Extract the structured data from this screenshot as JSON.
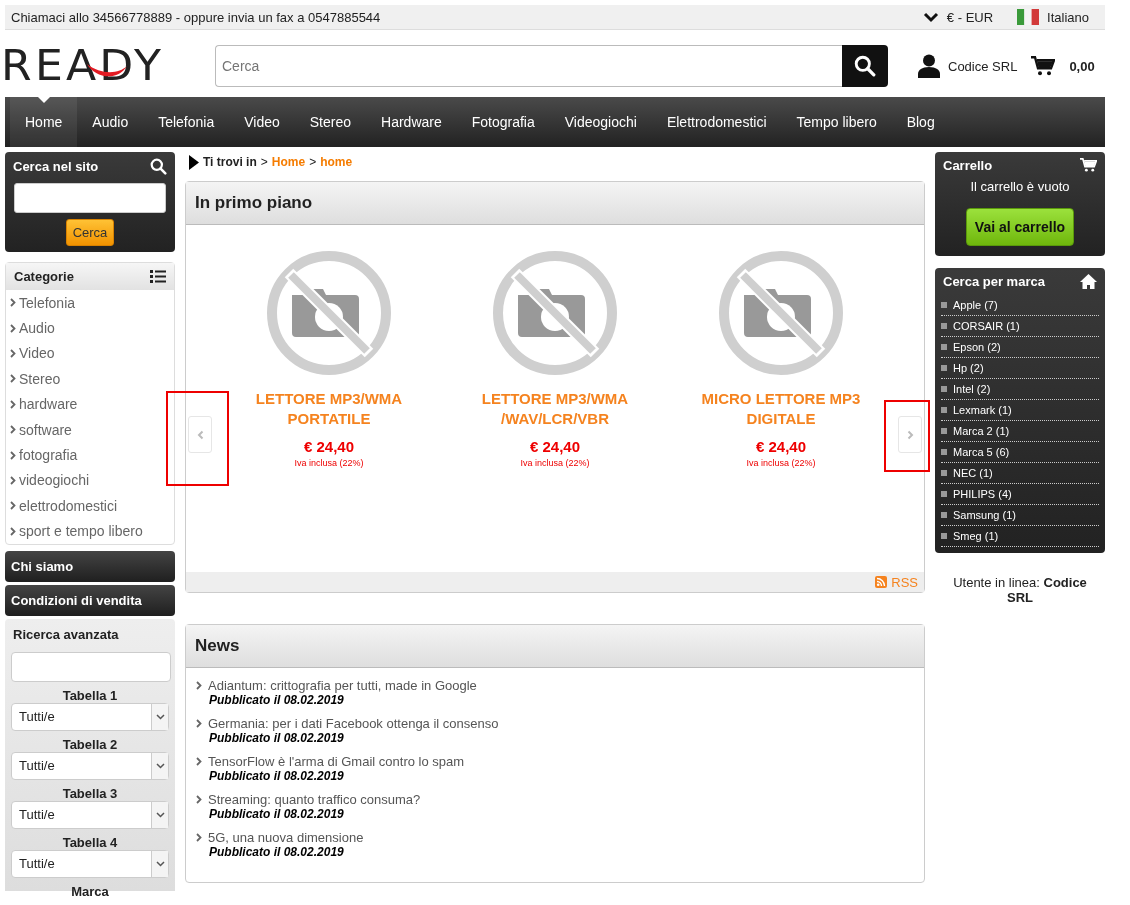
{
  "top_bar": {
    "contact": "Chiamaci allo 34566778889 - oppure invia un fax a 0547885544",
    "currency": "€ - EUR",
    "language": "Italiano"
  },
  "header": {
    "logo": "READY",
    "search": {
      "placeholder": "Cerca"
    },
    "user": "Codice SRL",
    "cart_total": "0,00"
  },
  "nav": [
    {
      "label": "Home",
      "selected": true
    },
    {
      "label": "Audio",
      "selected": false
    },
    {
      "label": "Telefonia",
      "selected": false
    },
    {
      "label": "Video",
      "selected": false
    },
    {
      "label": "Stereo",
      "selected": false
    },
    {
      "label": "Hardware",
      "selected": false
    },
    {
      "label": "Fotografia",
      "selected": false
    },
    {
      "label": "Videogiochi",
      "selected": false
    },
    {
      "label": "Elettrodomestici",
      "selected": false
    },
    {
      "label": "Tempo libero",
      "selected": false
    },
    {
      "label": "Blog",
      "selected": false
    }
  ],
  "left": {
    "site_search": {
      "title": "Cerca nel sito",
      "button": "Cerca"
    },
    "categories": {
      "title": "Categorie",
      "items": [
        "Telefonia",
        "Audio",
        "Video",
        "Stereo",
        "hardware",
        "software",
        "fotografia",
        "videogiochi",
        "elettrodomestici",
        "sport e tempo libero"
      ]
    },
    "links": [
      "Chi siamo",
      "Condizioni di vendita"
    ],
    "advanced_search": {
      "title": "Ricerca avanzata",
      "selects": [
        {
          "label": "Tabella 1",
          "value": "Tutti/e"
        },
        {
          "label": "Tabella 2",
          "value": "Tutti/e"
        },
        {
          "label": "Tabella 3",
          "value": "Tutti/e"
        },
        {
          "label": "Tabella 4",
          "value": "Tutti/e"
        }
      ],
      "next_label": "Marca"
    }
  },
  "breadcrumb": {
    "separator": ">",
    "items": [
      {
        "text": "Ti trovi in",
        "kind": "label"
      },
      {
        "text": "Home",
        "kind": "link"
      },
      {
        "text": "home",
        "kind": "current"
      }
    ]
  },
  "featured": {
    "title": "In primo piano",
    "prev": {
      "highlighted": true
    },
    "next": {
      "highlighted": true
    },
    "products": [
      {
        "name": "LETTORE MP3/WMA PORTATILE",
        "price": "€ 24,40",
        "tax": "Iva inclusa (22%)"
      },
      {
        "name": "LETTORE MP3/WMA /WAV/LCR/VBR",
        "price": "€ 24,40",
        "tax": "Iva inclusa (22%)"
      },
      {
        "name": "MICRO LETTORE MP3 DIGITALE",
        "price": "€ 24,40",
        "tax": "Iva inclusa (22%)"
      }
    ],
    "rss": "RSS"
  },
  "news": {
    "title": "News",
    "items": [
      {
        "title": "Adiantum: crittografia per tutti, made in Google",
        "date": "Pubblicato il 08.02.2019"
      },
      {
        "title": "Germania: per i dati Facebook ottenga il consenso",
        "date": "Pubblicato il 08.02.2019"
      },
      {
        "title": "TensorFlow è l'arma di Gmail contro lo spam",
        "date": "Pubblicato il 08.02.2019"
      },
      {
        "title": "Streaming: quanto traffico consuma?",
        "date": "Pubblicato il 08.02.2019"
      },
      {
        "title": "5G, una nuova dimensione",
        "date": "Pubblicato il 08.02.2019"
      }
    ]
  },
  "right": {
    "cart": {
      "title": "Carrello",
      "empty_text": "Il carrello è vuoto",
      "button": "Vai al carrello"
    },
    "brands": {
      "title": "Cerca per marca",
      "items": [
        "Apple (7)",
        "CORSAIR (1)",
        "Epson (2)",
        "Hp (2)",
        "Intel (2)",
        "Lexmark (1)",
        "Marca 2 (1)",
        "Marca 5 (6)",
        "NEC (1)",
        "PHILIPS (4)",
        "Samsung (1)",
        "Smeg (1)"
      ]
    },
    "online_user": "Utente in linea: **Codice SRL**"
  }
}
